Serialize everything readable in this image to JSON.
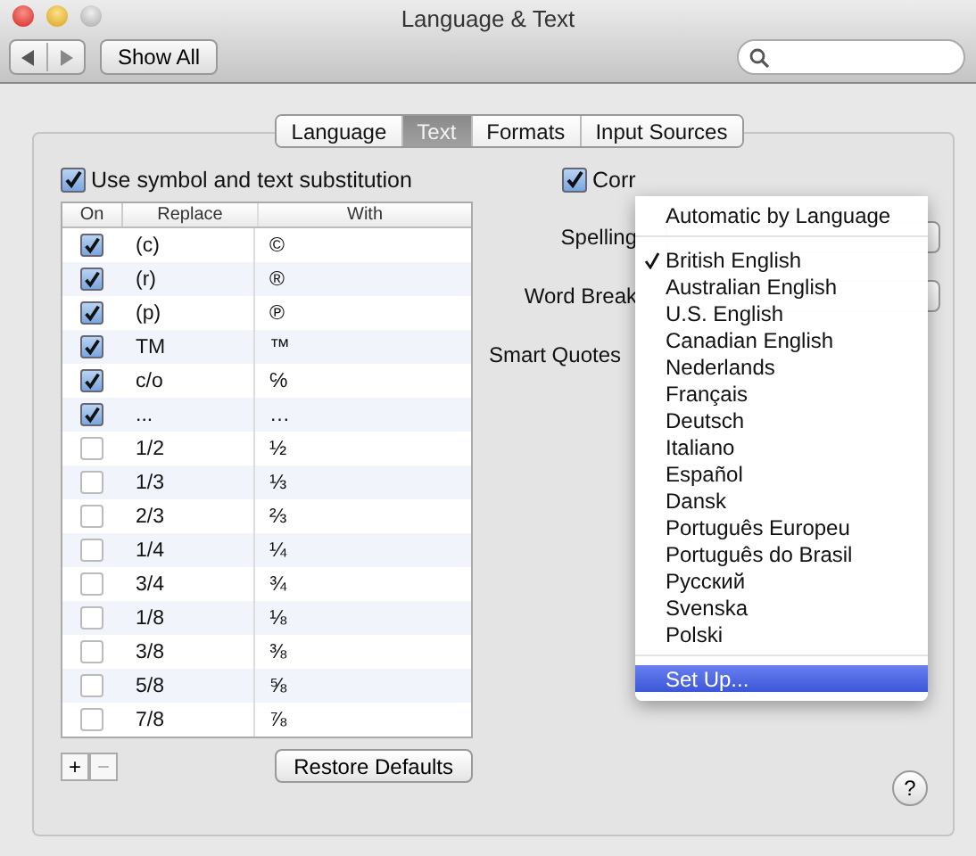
{
  "window": {
    "title": "Language & Text"
  },
  "toolbar": {
    "show_all": "Show All"
  },
  "tabs": [
    {
      "label": "Language",
      "selected": false
    },
    {
      "label": "Text",
      "selected": true
    },
    {
      "label": "Formats",
      "selected": false
    },
    {
      "label": "Input Sources",
      "selected": false
    }
  ],
  "substitution": {
    "label": "Use symbol and text substitution",
    "checked": true
  },
  "table": {
    "columns": [
      "On",
      "Replace",
      "With"
    ],
    "rows": [
      {
        "on": true,
        "replace": "(c)",
        "with": "©"
      },
      {
        "on": true,
        "replace": "(r)",
        "with": "®"
      },
      {
        "on": true,
        "replace": "(p)",
        "with": "℗"
      },
      {
        "on": true,
        "replace": "TM",
        "with": "™"
      },
      {
        "on": true,
        "replace": "c/o",
        "with": "℅"
      },
      {
        "on": true,
        "replace": "...",
        "with": "…"
      },
      {
        "on": false,
        "replace": "1/2",
        "with": "½"
      },
      {
        "on": false,
        "replace": "1/3",
        "with": "⅓"
      },
      {
        "on": false,
        "replace": "2/3",
        "with": "⅔"
      },
      {
        "on": false,
        "replace": "1/4",
        "with": "¼"
      },
      {
        "on": false,
        "replace": "3/4",
        "with": "¾"
      },
      {
        "on": false,
        "replace": "1/8",
        "with": "⅛"
      },
      {
        "on": false,
        "replace": "3/8",
        "with": "⅜"
      },
      {
        "on": false,
        "replace": "5/8",
        "with": "⅝"
      },
      {
        "on": false,
        "replace": "7/8",
        "with": "⅞"
      }
    ]
  },
  "table_buttons": {
    "add": "+",
    "remove": "−",
    "restore_defaults": "Restore Defaults"
  },
  "correct_spelling": {
    "label": "Corr",
    "checked": true
  },
  "labels": {
    "spelling": "Spelling",
    "word_break": "Word Break",
    "smart_quotes": "Smart Quotes"
  },
  "menu": {
    "items": [
      {
        "kind": "item",
        "label": "Automatic by Language",
        "checked": false,
        "highlighted": false
      },
      {
        "kind": "separator"
      },
      {
        "kind": "item",
        "label": "British English",
        "checked": true,
        "highlighted": false
      },
      {
        "kind": "item",
        "label": "Australian English",
        "checked": false,
        "highlighted": false
      },
      {
        "kind": "item",
        "label": "U.S. English",
        "checked": false,
        "highlighted": false
      },
      {
        "kind": "item",
        "label": "Canadian English",
        "checked": false,
        "highlighted": false
      },
      {
        "kind": "item",
        "label": "Nederlands",
        "checked": false,
        "highlighted": false
      },
      {
        "kind": "item",
        "label": "Français",
        "checked": false,
        "highlighted": false
      },
      {
        "kind": "item",
        "label": "Deutsch",
        "checked": false,
        "highlighted": false
      },
      {
        "kind": "item",
        "label": "Italiano",
        "checked": false,
        "highlighted": false
      },
      {
        "kind": "item",
        "label": "Español",
        "checked": false,
        "highlighted": false
      },
      {
        "kind": "item",
        "label": "Dansk",
        "checked": false,
        "highlighted": false
      },
      {
        "kind": "item",
        "label": "Português Europeu",
        "checked": false,
        "highlighted": false
      },
      {
        "kind": "item",
        "label": "Português do Brasil",
        "checked": false,
        "highlighted": false
      },
      {
        "kind": "item",
        "label": "Русский",
        "checked": false,
        "highlighted": false
      },
      {
        "kind": "item",
        "label": "Svenska",
        "checked": false,
        "highlighted": false
      },
      {
        "kind": "item",
        "label": "Polski",
        "checked": false,
        "highlighted": false
      },
      {
        "kind": "separator"
      },
      {
        "kind": "item",
        "label": "Set Up...",
        "checked": false,
        "highlighted": true
      }
    ]
  },
  "help": {
    "label": "?"
  }
}
